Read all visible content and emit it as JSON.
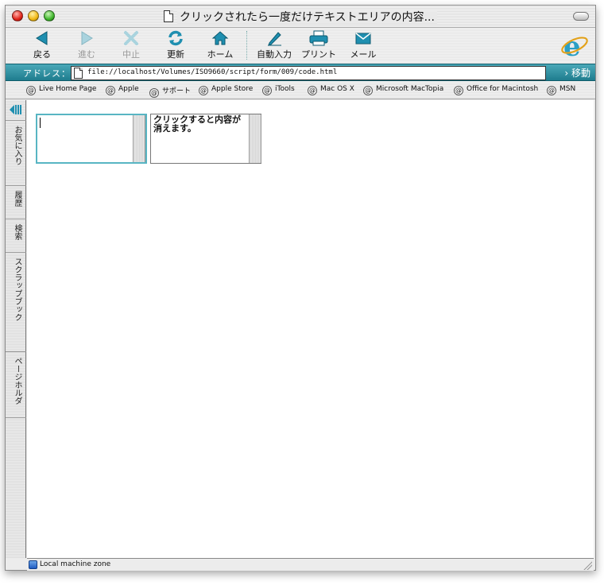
{
  "window": {
    "title": "クリックされたら一度だけテキストエリアの内容..."
  },
  "toolbar": {
    "back": "戻る",
    "forward": "進む",
    "stop": "中止",
    "refresh": "更新",
    "home": "ホーム",
    "autofill": "自動入力",
    "print": "プリント",
    "mail": "メール"
  },
  "address": {
    "label": "アドレス：",
    "url": "file://localhost/Volumes/ISO9660/script/form/009/code.html",
    "go": "› 移動"
  },
  "favorites": [
    "Live Home Page",
    "Apple",
    "サポート",
    "Apple Store",
    "iTools",
    "Mac OS X",
    "Microsoft MacTopia",
    "Office for Macintosh",
    "MSN"
  ],
  "sidebar_tabs": [
    "お気に入り",
    "履歴",
    "検索",
    "スクラップブック",
    "ページホルダ"
  ],
  "content": {
    "textarea1_value": "",
    "textarea2_value": "クリックすると内容が消えます。"
  },
  "status": {
    "zone": "Local machine zone"
  },
  "colors": {
    "accent": "#1f7d8e",
    "focus_ring": "#58b5c3"
  },
  "icons": {
    "back": "back-arrow-icon",
    "forward": "forward-arrow-icon",
    "stop": "stop-x-icon",
    "refresh": "refresh-icon",
    "home": "home-icon",
    "autofill": "pen-icon",
    "print": "printer-icon",
    "mail": "envelope-icon"
  }
}
